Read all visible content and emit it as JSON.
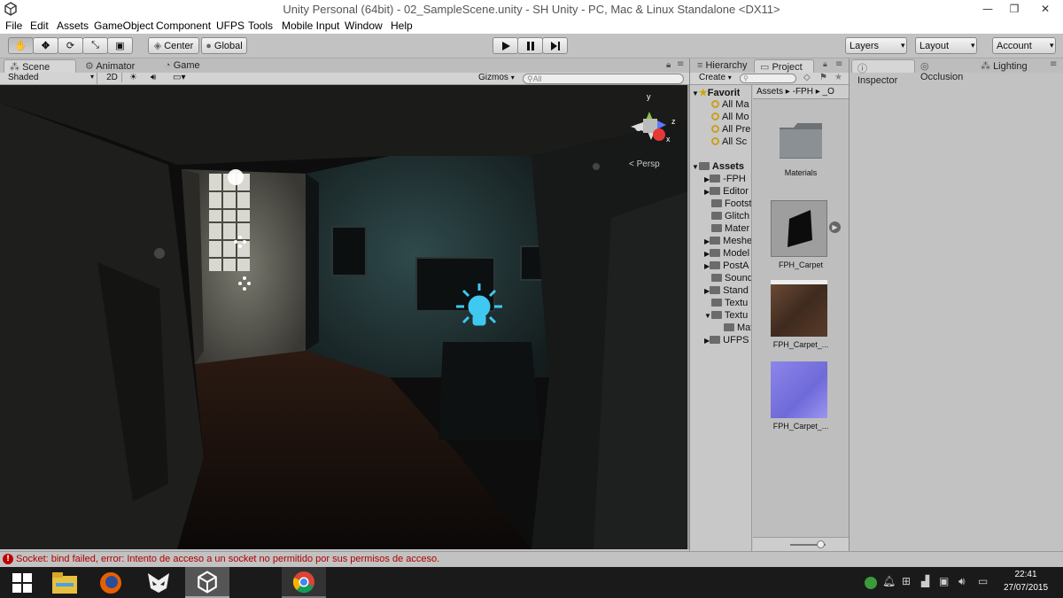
{
  "window": {
    "title": "Unity Personal (64bit) - 02_SampleScene.unity - SH Unity - PC, Mac & Linux Standalone <DX11>",
    "minimize": "—",
    "maximize": "❐",
    "close": "✕"
  },
  "menu": [
    "File",
    "Edit",
    "Assets",
    "GameObject",
    "Component",
    "UFPS",
    "Tools",
    "Mobile Input",
    "Window",
    "Help"
  ],
  "toolbar": {
    "pivot": "Center",
    "space": "Global",
    "layers": "Layers",
    "layout": "Layout",
    "account": "Account"
  },
  "scene": {
    "tabs": [
      "Scene",
      "Animator",
      "Game"
    ],
    "shading": "Shaded",
    "mode2d": "2D",
    "gizmos": "Gizmos",
    "search_placeholder": "All",
    "persp": "Persp",
    "axes": {
      "y": "y",
      "z": "z",
      "x": "x"
    }
  },
  "project": {
    "tabs": [
      "Hierarchy",
      "Project"
    ],
    "create": "Create",
    "favorites_label": "Favorit",
    "favorites": [
      "All Ma",
      "All Mo",
      "All Pre",
      "All Sc"
    ],
    "assets_label": "Assets",
    "folders": [
      "-FPH",
      "Editor",
      "Footst",
      "Glitch",
      "Mater",
      "Meshe",
      "Model",
      "PostA",
      "Sound",
      "Stand",
      "Textu",
      "Mat",
      "UFPS"
    ],
    "breadcrumb": [
      "Assets",
      "-FPH",
      "_O"
    ],
    "items": [
      {
        "name": "Materials",
        "kind": "folder"
      },
      {
        "name": "FPH_Carpet",
        "kind": "material"
      },
      {
        "name": "FPH_Carpet_...",
        "kind": "texture"
      },
      {
        "name": "FPH_Carpet_...",
        "kind": "normal"
      }
    ]
  },
  "inspector": {
    "tabs": [
      "Inspector",
      "Occlusion",
      "Lighting"
    ]
  },
  "status": {
    "message": "Socket: bind failed, error: Intento de acceso a un socket no permitido por sus permisos de acceso."
  },
  "taskbar": {
    "time": "22:41",
    "date": "27/07/2015"
  },
  "colors": {
    "error": "#c00000",
    "light_gizmo": "#3fc8f0",
    "taskbar": "#1a1a1a"
  }
}
